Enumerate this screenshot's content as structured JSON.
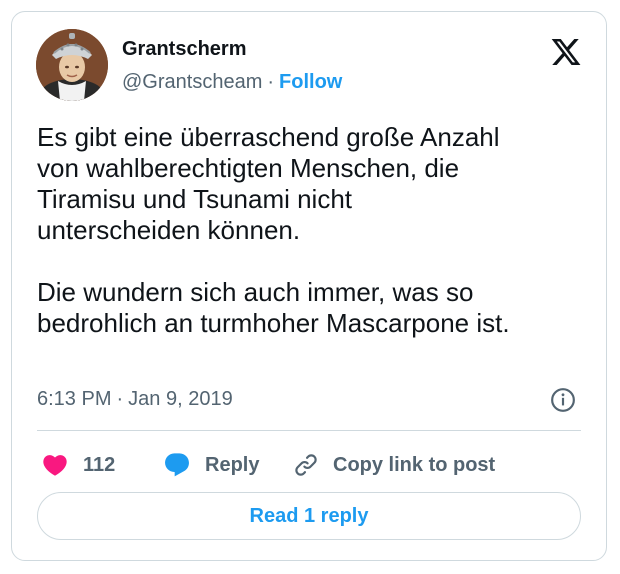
{
  "author": {
    "name": "Grantscherm",
    "handle": "@Grantscheam",
    "separator": "·",
    "follow_label": "Follow",
    "avatar_icon": "profile-photo-person-with-colander-hat"
  },
  "brand": {
    "logo_icon": "x-logo-icon"
  },
  "post": {
    "text": "Es gibt eine überraschend große Anzahl\nvon wahlberechtigten Menschen, die\nTiramisu und Tsunami nicht\nunterscheiden können.\n\nDie wundern sich auch immer, was so\nbedrohlich an turmhoher Mascarpone ist.",
    "time": "6:13 PM",
    "separator": "·",
    "date": "Jan 9, 2019"
  },
  "actions": {
    "like_count": "112",
    "reply_label": "Reply",
    "copy_label": "Copy link to post"
  },
  "read_replies_label": "Read 1 reply",
  "colors": {
    "accent": "#1d9bf0",
    "like": "#f91880",
    "text_primary": "#0f1419",
    "text_secondary": "#536471",
    "border": "#cfd9de"
  }
}
